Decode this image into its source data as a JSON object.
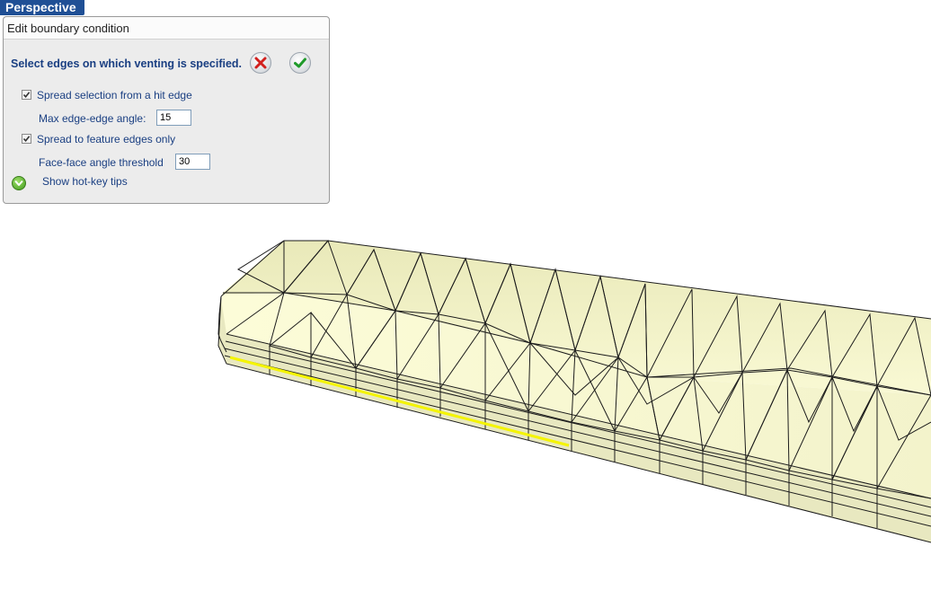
{
  "view": {
    "mode_label": "Perspective"
  },
  "panel": {
    "title": "Edit boundary condition",
    "instruction": "Select edges on which venting is specified.",
    "buttons": {
      "cancel_icon": "cancel-x-icon",
      "ok_icon": "confirm-check-icon"
    },
    "spread_from_hit_edge": {
      "label": "Spread selection from a hit edge",
      "checked": true
    },
    "max_edge_angle": {
      "label": "Max edge-edge angle:",
      "value": "15"
    },
    "spread_feature_edges": {
      "label": "Spread to feature edges only",
      "checked": true
    },
    "face_angle_threshold": {
      "label": "Face-face angle threshold",
      "value": "30"
    },
    "hotkey_tips": {
      "label": "Show hot-key tips",
      "icon": "chevron-down-icon"
    }
  },
  "colors": {
    "accent": "#1f4f95",
    "label_text": "#1a3f82",
    "mesh_face_light": "#fbfbd6",
    "mesh_face_top": "#eeeebf",
    "mesh_face_side": "#e6e6bc",
    "selected_edge": "#f4f400"
  }
}
